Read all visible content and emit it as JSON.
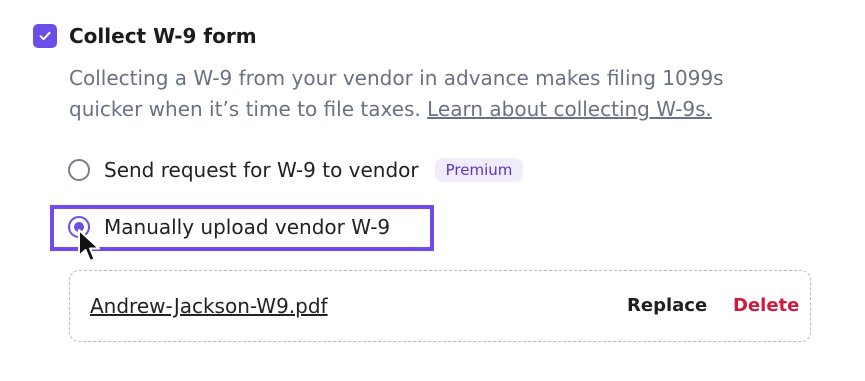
{
  "collect": {
    "checked": true,
    "title": "Collect W-9 form",
    "description": "Collecting a W-9 from your vendor in advance makes filing 1099s quicker when it’s time to file taxes.",
    "link_label": "Learn about collecting W-9s."
  },
  "options": {
    "send_request_label": "Send request for W-9 to vendor",
    "premium_badge": "Premium",
    "manual_upload_label": "Manually upload vendor W-9",
    "selected": "manual_upload"
  },
  "file": {
    "name": "Andrew-Jackson-W9.pdf",
    "replace_label": "Replace",
    "delete_label": "Delete"
  },
  "colors": {
    "accent": "#6b4ee6",
    "highlight": "#7448f0",
    "delete": "#d1193b",
    "badge_bg": "#f1ecfb",
    "muted_text": "#6a7184"
  }
}
